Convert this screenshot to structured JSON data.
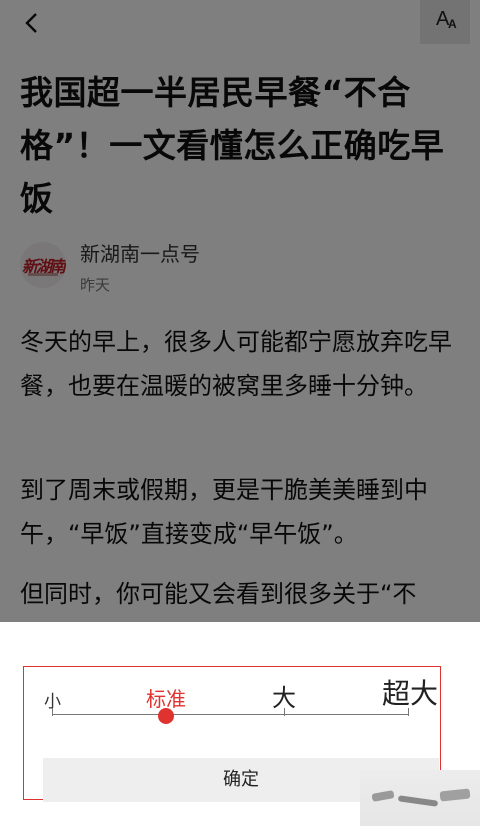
{
  "header": {
    "back_icon": "chevron-left-icon",
    "font_size_icon": "font-size-icon",
    "font_icon_glyph_big": "A",
    "font_icon_glyph_small": "A"
  },
  "article": {
    "title": "我国超一半居民早餐“不合格”！一文看懂怎么正确吃早饭",
    "author": {
      "avatar_logo": "新湖南",
      "name": "新湖南一点号",
      "time": "昨天"
    },
    "paragraphs": [
      "冬天的早上，很多人可能都宁愿放弃吃早餐，也要在温暖的被窝里多睡十分钟。",
      "到了周末或假期，更是干脆美美睡到中午，“早饭”直接变成“早午饭”。",
      "但同时，你可能又会看到很多关于“不"
    ]
  },
  "font_panel": {
    "options": [
      "小",
      "标准",
      "大",
      "超大"
    ],
    "selected": "标准",
    "selected_index": 1,
    "confirm_label": "确定"
  },
  "colors": {
    "accent": "#e0332f",
    "overlay": "rgba(0,0,0,0.5)"
  }
}
